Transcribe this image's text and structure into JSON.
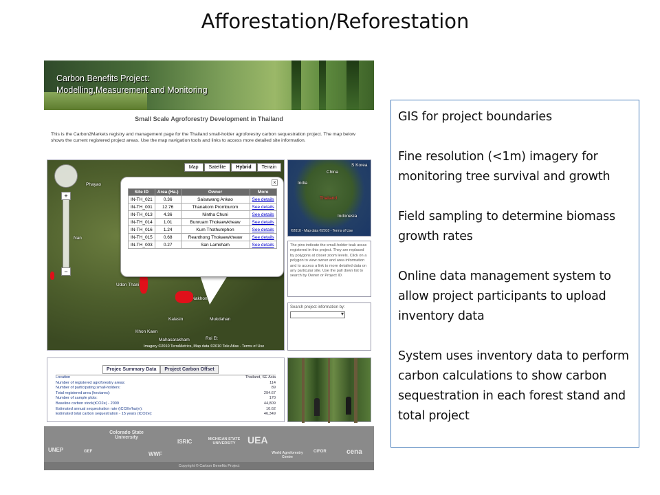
{
  "slide": {
    "title": "Afforestation/Reforestation"
  },
  "webpage": {
    "banner": {
      "line1": "Carbon Benefits Project:",
      "line2": "Modelling,Measurement and Monitoring"
    },
    "heading": "Small Scale Agroforestry Development in Thailand",
    "intro": "This is the Carbon2Markets registry and management page for the Thailand small-holder agroforestry carbon sequestration project. The map below shows the current registered project areas. Use the map navigation tools and links to access more detailed site information.",
    "map": {
      "tabs": [
        "Map",
        "Satellite",
        "Hybrid",
        "Terrain"
      ],
      "active_tab": "Hybrid",
      "places": [
        "Phayao",
        "Nan",
        "Udon Thani",
        "Sakon Nakhon",
        "Khon Kaen",
        "Kalasin",
        "Mukdahan",
        "Mahasarakham",
        "Roi Et"
      ],
      "footer": "Imagery ©2010 TerraMetrics, Map data ©2010 Tele Atlas · Terms of Use"
    },
    "popup": {
      "columns": [
        "Site ID",
        "Area (Ha.)",
        "Owner",
        "More"
      ],
      "link_label": "See details",
      "rows": [
        {
          "id": "IN-TH_021",
          "area": "0.36",
          "owner": "Saisawang Ankao"
        },
        {
          "id": "IN-TH_001",
          "area": "12.76",
          "owner": "Thanakorn Promburom"
        },
        {
          "id": "IN-TH_013",
          "area": "4.36",
          "owner": "Nintha Chuni"
        },
        {
          "id": "IN-TH_014",
          "area": "1.01",
          "owner": "Bunruam Thokaewkheaw"
        },
        {
          "id": "IN-TH_016",
          "area": "1.24",
          "owner": "Kum Thothumphon"
        },
        {
          "id": "IN-TH_015",
          "area": "0.68",
          "owner": "Reanthong Thokaewkheaw"
        },
        {
          "id": "IN-TH_003",
          "area": "0.27",
          "owner": "San Lamkham"
        }
      ]
    },
    "mini_map": {
      "labels": [
        "China",
        "India",
        "Thailand",
        "Indonesia",
        "S Korea"
      ],
      "footer": "©2010 - Map data ©2010 - Terms of Use"
    },
    "info_text": "The pins indicate the small-holder teak areas registered in this project. They are replaced by polygons at closer zoom levels. Click on a polygon to view owner and area information and to access a link to more detailed data on any particular site. Use the pull down list to search by Owner or Project ID.",
    "search": {
      "label": "Search project information by:",
      "value": ""
    },
    "summary": {
      "tabs": [
        "Projec Summary Data",
        "Project Carbon Offset"
      ],
      "rows": [
        {
          "label": "Location",
          "value": "Thailand, SE Asia"
        },
        {
          "label": "Number of registered agroforestry areas:",
          "value": "114"
        },
        {
          "label": "Number of participating small-holders:",
          "value": "89"
        },
        {
          "label": "Total registered area (hectares):",
          "value": "294.67"
        },
        {
          "label": "Number of sample plots:",
          "value": "170"
        },
        {
          "label": "Baseline carbon stock(tCO2e) - 2009",
          "value": "44,809"
        },
        {
          "label": "Estimated annual sequestration rate (tCO2e/ha/yr):",
          "value": "10.62"
        },
        {
          "label": "Estimated total carbon sequestration - 15 years (tCO2e):",
          "value": "46,349"
        }
      ]
    },
    "logos": [
      "UNEP",
      "GEF",
      "Colorado State University",
      "WWF",
      "ISRIC",
      "MICHIGAN STATE UNIVERSITY",
      "UEA",
      "World Agroforestry Centre",
      "CIFOR",
      "cena"
    ],
    "copyright": "Copyright © Carbon Benefits Project"
  },
  "textbox": {
    "paragraphs": [
      "GIS for project boundaries",
      "Fine resolution (<1m) imagery for monitoring tree survival and growth",
      "Field sampling to determine biomass growth rates",
      "Online data management system to allow  project participants to upload inventory data",
      "System uses inventory data to perform carbon calculations  to show carbon sequestration in each forest stand and total project"
    ]
  },
  "colors": {
    "accent_border": "#4a7ebb",
    "link": "#0000cc",
    "polygon": "#e0101a"
  }
}
